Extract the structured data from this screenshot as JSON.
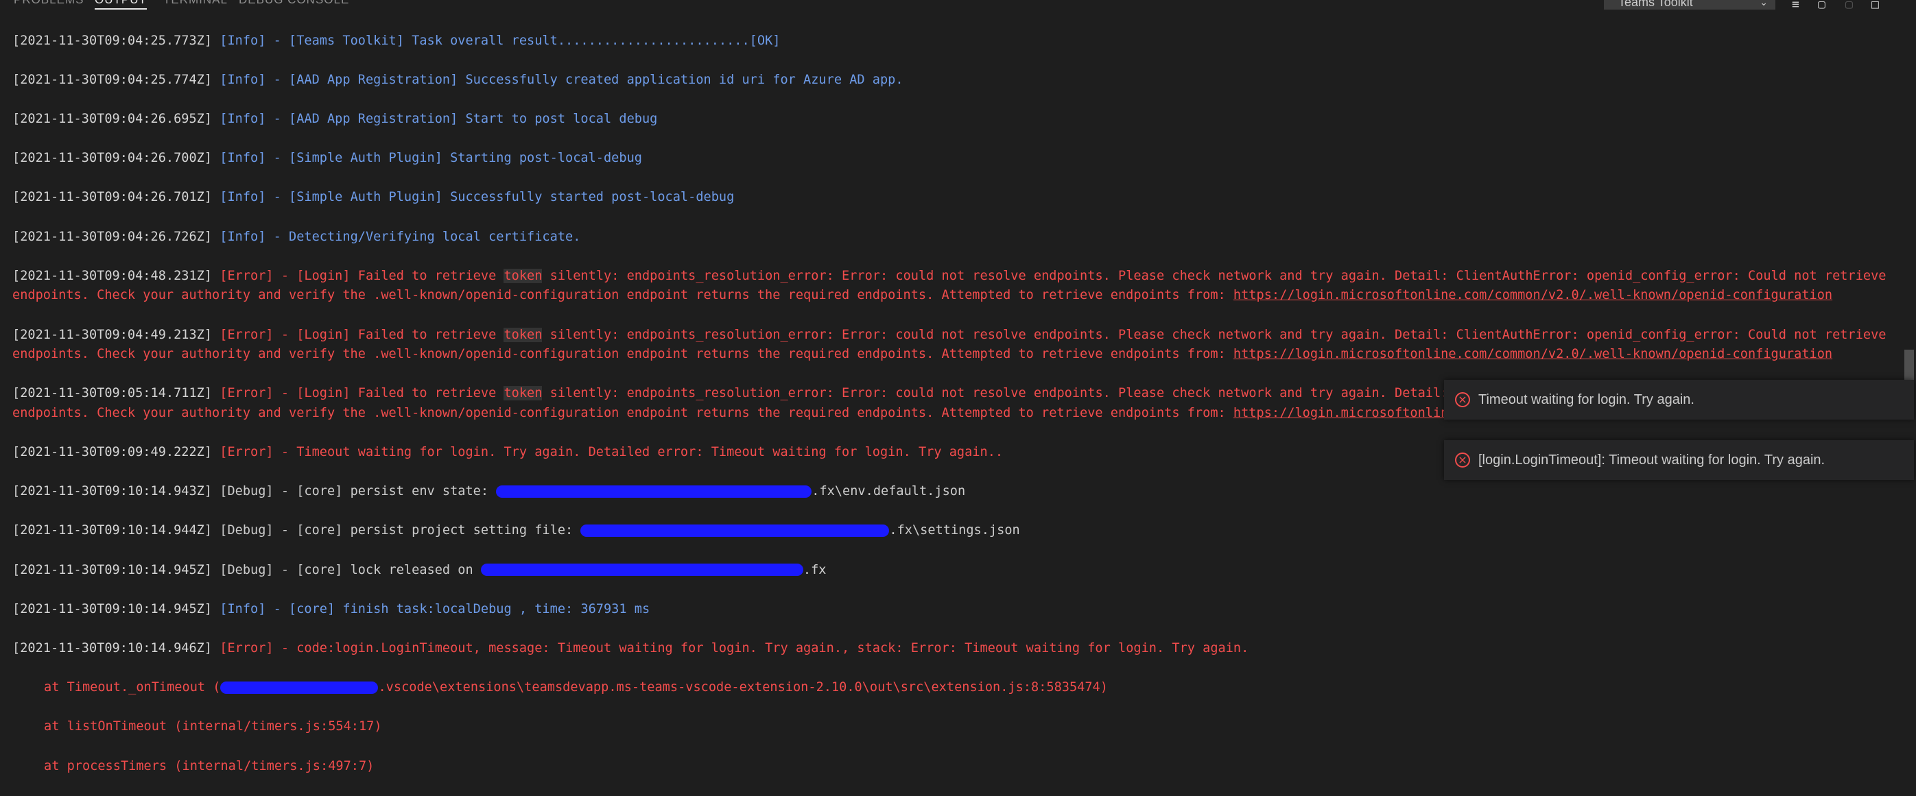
{
  "panel": {
    "tabs": [
      "PROBLEMS",
      "OUTPUT",
      "TERMINAL",
      "DEBUG CONSOLE"
    ],
    "active_tab": "OUTPUT",
    "channel": "Teams Toolkit"
  },
  "log": {
    "l0": {
      "ts": "[2021-11-30T09:04:25.773Z]",
      "msg": "[Info] - [Teams Toolkit] Task overall result.........................[OK]"
    },
    "l1": {
      "ts": "[2021-11-30T09:04:25.774Z]",
      "msg": "[Info] - [AAD App Registration] Successfully created application id uri for Azure AD app."
    },
    "l2": {
      "ts": "[2021-11-30T09:04:26.695Z]",
      "msg": "[Info] - [AAD App Registration] Start to post local debug"
    },
    "l3": {
      "ts": "[2021-11-30T09:04:26.700Z]",
      "msg": "[Info] - [Simple Auth Plugin] Starting post-local-debug"
    },
    "l4": {
      "ts": "[2021-11-30T09:04:26.701Z]",
      "msg": "[Info] - [Simple Auth Plugin] Successfully started post-local-debug"
    },
    "l5": {
      "ts": "[2021-11-30T09:04:26.726Z]",
      "msg": "[Info] - Detecting/Verifying local certificate."
    },
    "e1": {
      "ts": "[2021-11-30T09:04:48.231Z]"
    },
    "e2": {
      "ts": "[2021-11-30T09:04:49.213Z]"
    },
    "e3": {
      "ts": "[2021-11-30T09:05:14.711Z]"
    },
    "err_pre": "[Error] - [Login] Failed to retrieve ",
    "err_token": "token",
    "err_post": " silently: endpoints_resolution_error: Error: could not resolve endpoints. Please check network and try again. Detail: ClientAuthError: openid_config_error: Could not retrieve endpoints. Check your authority and verify the .well-known/openid-configuration endpoint returns the required endpoints. Attempted to retrieve endpoints from: ",
    "err_link": "https://login.microsoftonline.com/common/v2.0/.well-known/openid-configuration",
    "l9": {
      "ts": "[2021-11-30T09:09:49.222Z]",
      "msg": "[Error] - Timeout waiting for login. Try again. Detailed error: Timeout waiting for login. Try again.."
    },
    "l10": {
      "ts": "[2021-11-30T09:10:14.943Z]",
      "pre": "[Debug] - [core] persist env state: ",
      "post": ".fx\\env.default.json"
    },
    "l11": {
      "ts": "[2021-11-30T09:10:14.944Z]",
      "pre": "[Debug] - [core] persist project setting file: ",
      "post": ".fx\\settings.json"
    },
    "l12": {
      "ts": "[2021-11-30T09:10:14.945Z]",
      "pre": "[Debug] - [core] lock released on ",
      "post": ".fx"
    },
    "l13": {
      "ts": "[2021-11-30T09:10:14.945Z]",
      "msg": "[Info] - [core] finish task:localDebug , time: 367931 ms"
    },
    "l14": {
      "ts": "[2021-11-30T09:10:14.946Z]",
      "msg": "[Error] - code:login.LoginTimeout, message: Timeout waiting for login. Try again., stack: Error: Timeout waiting for login. Try again."
    },
    "s1_pre": "at Timeout._onTimeout (",
    "s1_post": ".vscode\\extensions\\teamsdevapp.ms-teams-vscode-extension-2.10.0\\out\\src\\extension.js:8:5835474)",
    "s2": "at listOnTimeout (internal/timers.js:554:17)",
    "s3": "at processTimers (internal/timers.js:497:7)"
  },
  "notifications": [
    {
      "icon": "error-icon",
      "text": "Timeout waiting for login. Try again."
    },
    {
      "icon": "error-icon",
      "text": "[login.LoginTimeout]: Timeout waiting for login. Try again."
    }
  ],
  "colors": {
    "info": "#6d9be8",
    "error": "#f14c4c",
    "redaction": "#1a1aff"
  }
}
